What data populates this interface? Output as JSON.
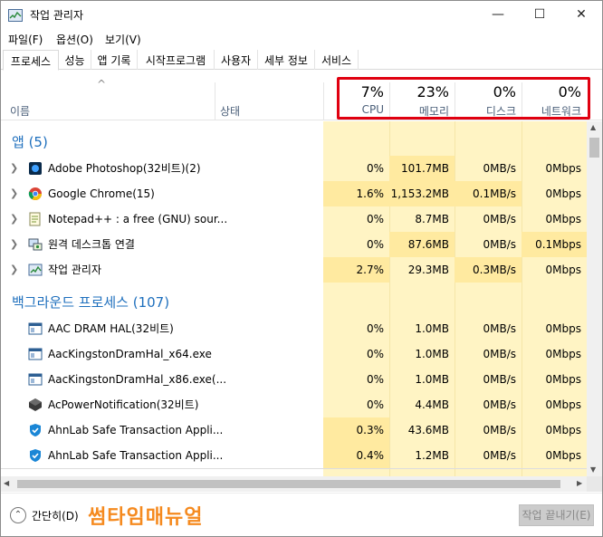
{
  "window": {
    "title": "작업 관리자",
    "minimize": "—",
    "maximize": "☐",
    "close": "✕"
  },
  "menu": [
    "파일(F)",
    "옵션(O)",
    "보기(V)"
  ],
  "tabs": [
    "프로세스",
    "성능",
    "앱 기록",
    "시작프로그램",
    "사용자",
    "세부 정보",
    "서비스"
  ],
  "header": {
    "sort_indicator": "^",
    "name": "이름",
    "status": "상태",
    "cpu_pct": "7%",
    "cpu": "CPU",
    "mem_pct": "23%",
    "mem": "메모리",
    "disk_pct": "0%",
    "disk": "디스크",
    "net_pct": "0%",
    "net": "네트워크"
  },
  "groups": {
    "apps": "앱 (5)",
    "background": "백그라운드 프로세스 (107)"
  },
  "apps": [
    {
      "name": "Adobe Photoshop(32비트)(2)",
      "icon": "photoshop-icon",
      "cpu": "0%",
      "mem": "101.7MB",
      "disk": "0MB/s",
      "net": "0Mbps"
    },
    {
      "name": "Google Chrome(15)",
      "icon": "chrome-icon",
      "cpu": "1.6%",
      "mem": "1,153.2MB",
      "disk": "0.1MB/s",
      "net": "0Mbps"
    },
    {
      "name": "Notepad++ : a free (GNU) sour...",
      "icon": "notepad-icon",
      "cpu": "0%",
      "mem": "8.7MB",
      "disk": "0MB/s",
      "net": "0Mbps"
    },
    {
      "name": "원격 데스크톱 연결",
      "icon": "remote-desktop-icon",
      "cpu": "0%",
      "mem": "87.6MB",
      "disk": "0MB/s",
      "net": "0.1Mbps"
    },
    {
      "name": "작업 관리자",
      "icon": "task-manager-icon",
      "cpu": "2.7%",
      "mem": "29.3MB",
      "disk": "0.3MB/s",
      "net": "0Mbps"
    }
  ],
  "background": [
    {
      "name": "AAC DRAM HAL(32비트)",
      "icon": "service-window-icon",
      "cpu": "0%",
      "mem": "1.0MB",
      "disk": "0MB/s",
      "net": "0Mbps"
    },
    {
      "name": "AacKingstonDramHal_x64.exe",
      "icon": "service-window-icon",
      "cpu": "0%",
      "mem": "1.0MB",
      "disk": "0MB/s",
      "net": "0Mbps"
    },
    {
      "name": "AacKingstonDramHal_x86.exe(...",
      "icon": "service-window-icon",
      "cpu": "0%",
      "mem": "1.0MB",
      "disk": "0MB/s",
      "net": "0Mbps"
    },
    {
      "name": "AcPowerNotification(32비트)",
      "icon": "cube-icon",
      "cpu": "0%",
      "mem": "4.4MB",
      "disk": "0MB/s",
      "net": "0Mbps"
    },
    {
      "name": "AhnLab Safe Transaction Appli...",
      "icon": "ahnlab-shield-icon",
      "cpu": "0.3%",
      "mem": "43.6MB",
      "disk": "0MB/s",
      "net": "0Mbps"
    },
    {
      "name": "AhnLab Safe Transaction Appli...",
      "icon": "ahnlab-shield-icon",
      "cpu": "0.4%",
      "mem": "1.2MB",
      "disk": "0MB/s",
      "net": "0Mbps"
    }
  ],
  "footer": {
    "fewer_details": "간단히(D)",
    "watermark": "썸타임매뉴얼",
    "end_task": "작업 끝내기(E)"
  },
  "colors": {
    "heat_light": "#fff4c4",
    "heat_mid": "#ffefb0",
    "group_text": "#1e6fbd",
    "highlight_box": "#e00010"
  }
}
